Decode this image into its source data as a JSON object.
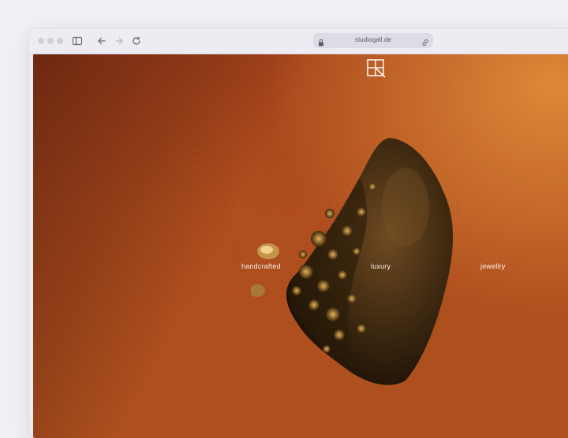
{
  "browser": {
    "url": "studiogall.de",
    "icons": [
      "sidebar-icon",
      "back-icon",
      "forward-icon",
      "reload-icon",
      "lock-icon",
      "link-icon"
    ]
  },
  "page": {
    "logo": "studiogall-logo-icon",
    "tagline": {
      "word1": "handcrafted",
      "word2": "luxury",
      "word3": "jewellry"
    }
  },
  "colors": {
    "background_dark": "#a8431a",
    "background_glow": "#eb963c",
    "text": "#fbf1ea"
  }
}
